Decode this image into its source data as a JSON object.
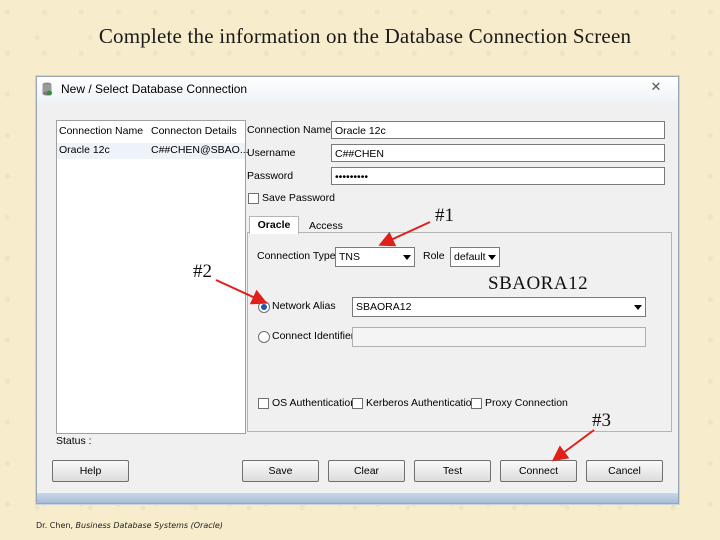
{
  "slide": {
    "title": "Complete the information on the Database Connection Screen",
    "footer_author": "Dr. Chen, ",
    "footer_course": "Business Database Systems (Oracle)"
  },
  "dialog": {
    "title": "New / Select Database Connection",
    "list": {
      "col_name": "Connection Name",
      "col_details": "Connecton Details",
      "rows": [
        {
          "name": "Oracle 12c",
          "details": "C##CHEN@SBAO..."
        }
      ]
    },
    "form": {
      "connection_name_label": "Connection Name",
      "connection_name_value": "Oracle 12c",
      "username_label": "Username",
      "username_value": "C##CHEN",
      "password_label": "Password",
      "password_value": "•••••••••",
      "save_password_label": "Save Password",
      "tabs": [
        "Oracle",
        "Access"
      ],
      "connection_type_label": "Connection Type",
      "connection_type_value": "TNS",
      "role_label": "Role",
      "role_value": "default",
      "network_alias_label": "Network Alias",
      "network_alias_value": "SBAORA12",
      "connect_identifier_label": "Connect Identifier",
      "os_auth_label": "OS Authentication",
      "kerberos_auth_label": "Kerberos Authentication",
      "proxy_label": "Proxy Connection"
    },
    "status_label": "Status :",
    "buttons": {
      "help": "Help",
      "save": "Save",
      "clear": "Clear",
      "test": "Test",
      "connect": "Connect",
      "cancel": "Cancel"
    }
  },
  "annotations": {
    "one": "#1",
    "two": "#2",
    "three": "#3",
    "alias_callout": "SBAORA12",
    "arrow_color": "#e0201b"
  }
}
